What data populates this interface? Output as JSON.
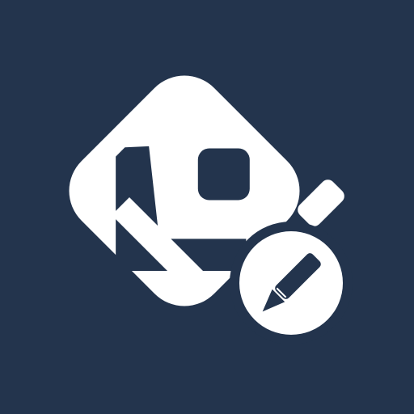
{
  "app_icon": {
    "icon_name": "edit-logo-icon",
    "colors": {
      "background": "#23344D",
      "foreground": "#FFFFFF"
    }
  }
}
